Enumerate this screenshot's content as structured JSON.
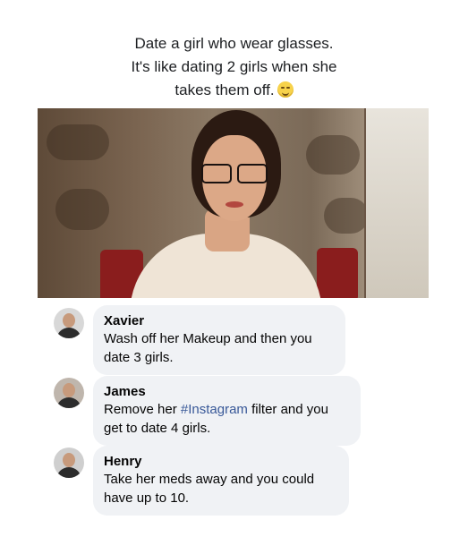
{
  "caption": {
    "line1": "Date a girl who wear glasses.",
    "line2": "It's like dating 2 girls when she",
    "line3": "takes them off."
  },
  "comments": [
    {
      "author": "Xavier",
      "text_line1": "Wash off her Makeup and then you",
      "text_line2": "date 3 girls."
    },
    {
      "author": "James",
      "text_prefix": "Remove her ",
      "hashtag": "#Instagram",
      "text_suffix": " filter and you",
      "text_line2": "get to date 4 girls."
    },
    {
      "author": "Henry",
      "text_line1": "Take her meds away and you could",
      "text_line2": "have up to 10."
    }
  ],
  "colors": {
    "bubble": "#f0f2f5",
    "hashtag": "#385898",
    "text": "#050505"
  }
}
